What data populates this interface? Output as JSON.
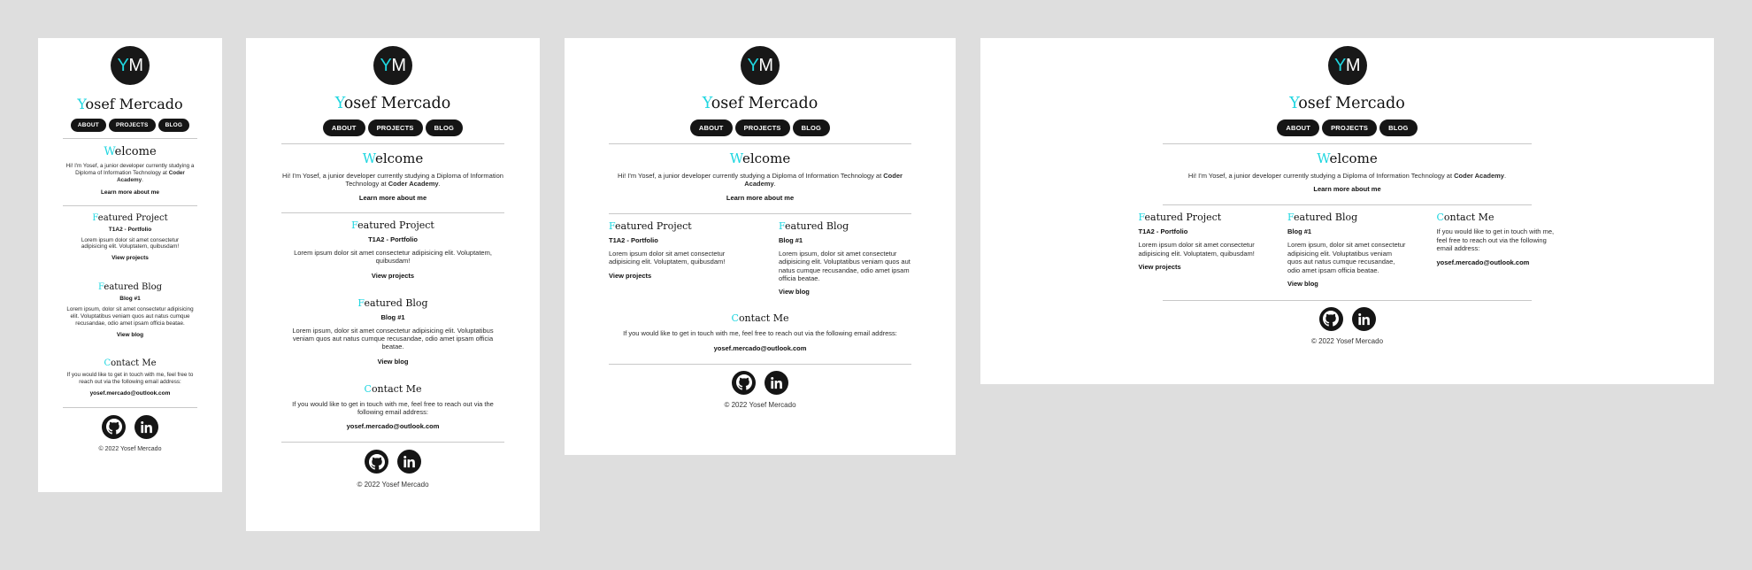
{
  "site": {
    "logo_initial_1": "Y",
    "logo_initial_2": "M",
    "name_first_letter": "Y",
    "name_rest": "osef Mercado",
    "nav": [
      "ABOUT",
      "PROJECTS",
      "BLOG"
    ]
  },
  "welcome": {
    "heading_first": "W",
    "heading_rest": "elcome",
    "text_before": "Hi! I'm Yosef, a junior developer currently studying a Diploma of Information Technology at ",
    "text_bold": "Coder Academy",
    "text_after": ".",
    "link": "Learn more about me"
  },
  "project": {
    "heading_first": "F",
    "heading_rest": "eatured Project",
    "subtitle": "T1A2 - Portfolio",
    "text": "Lorem ipsum dolor sit amet consectetur adipisicing elit. Voluptatem, quibusdam!",
    "link": "View projects"
  },
  "blog": {
    "heading_first": "F",
    "heading_rest": "eatured Blog",
    "subtitle": "Blog #1",
    "text": "Lorem ipsum, dolor sit amet consectetur adipisicing elit. Voluptatibus veniam quos aut natus cumque recusandae, odio amet ipsam officia beatae.",
    "link": "View blog"
  },
  "contact": {
    "heading_first": "C",
    "heading_rest": "ontact Me",
    "text": "If you would like to get in touch with me, feel free to reach out via the following email address:",
    "email": "yosef.mercado@outlook.com"
  },
  "footer": {
    "icons": [
      "github-icon",
      "linkedin-icon"
    ],
    "copyright": "© 2022 Yosef Mercado"
  },
  "colors": {
    "accent": "#1fd6e0",
    "dark": "#151515",
    "page_bg": "#dedede",
    "card_bg": "#ffffff"
  }
}
